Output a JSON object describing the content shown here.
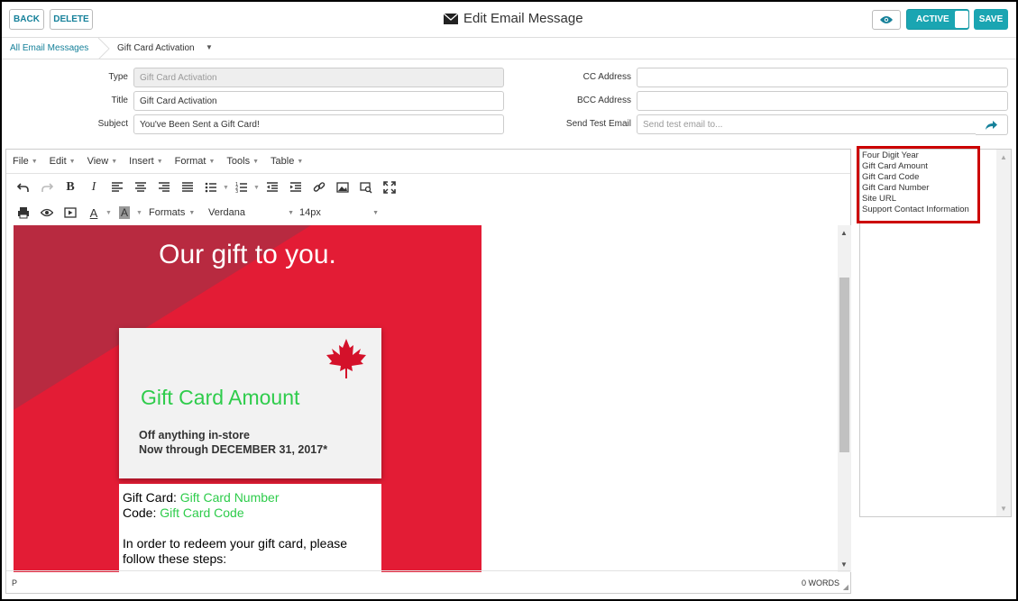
{
  "toolbar": {
    "back_label": "BACK",
    "delete_label": "DELETE",
    "title": "Edit Email Message",
    "active_label": "ACTIVE",
    "save_label": "SAVE"
  },
  "breadcrumb": {
    "root": "All Email Messages",
    "current": "Gift Card Activation"
  },
  "form": {
    "type_label": "Type",
    "type_value": "Gift Card Activation",
    "title_label": "Title",
    "title_value": "Gift Card Activation",
    "subject_label": "Subject",
    "subject_value": "You've Been Sent a Gift Card!",
    "cc_label": "CC Address",
    "cc_value": "",
    "bcc_label": "BCC Address",
    "bcc_value": "",
    "send_test_label": "Send Test Email",
    "send_test_placeholder": "Send test email to..."
  },
  "editor": {
    "menus": [
      "File",
      "Edit",
      "View",
      "Insert",
      "Format",
      "Tools",
      "Table"
    ],
    "formats_label": "Formats",
    "font_family": "Verdana",
    "font_size": "14px",
    "status_path": "P",
    "word_count": "0 WORDS"
  },
  "email_content": {
    "heading": "Our gift to you.",
    "card_amount": "Gift Card Amount",
    "offer_line1": "Off anything in-store",
    "offer_line2": "Now through DECEMBER 31, 2017*",
    "gift_card_label": "Gift Card: ",
    "gift_card_value": "Gift Card Number",
    "code_label": "Code: ",
    "code_value": "Gift Card Code",
    "redeem_text": "In order to redeem your gift card, please follow these steps:"
  },
  "placeholders": [
    "Four Digit Year",
    "Gift Card Amount",
    "Gift Card Code",
    "Gift Card Number",
    "Site URL",
    "Support Contact Information"
  ],
  "colors": {
    "accent": "#1aa5b2",
    "hero_red": "#e31c35",
    "placeholder_green": "#2ecc4b",
    "highlight_red": "#cc0000"
  }
}
